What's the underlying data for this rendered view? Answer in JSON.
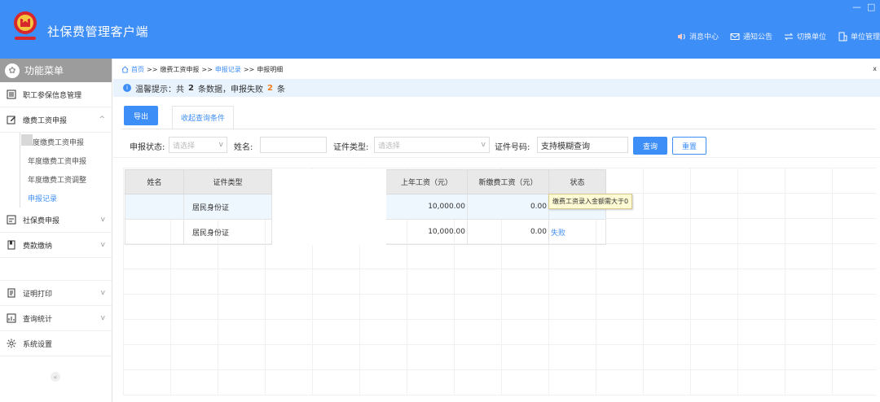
{
  "header": {
    "title": "社保费管理客户端",
    "window_controls": [
      "—",
      "□"
    ],
    "nav": [
      {
        "label": "消息中心",
        "icon": "speaker-icon"
      },
      {
        "label": "通知公告",
        "icon": "mail-icon"
      },
      {
        "label": "切换单位",
        "icon": "switch-icon"
      },
      {
        "label": "单位管理",
        "icon": "building-icon"
      }
    ]
  },
  "sidebar": {
    "title": "功能菜单",
    "items": [
      {
        "label": "职工参保信息管理"
      },
      {
        "label": "缴费工资申报"
      },
      {
        "label": "社保费申报"
      },
      {
        "label": "费款缴纳"
      },
      {
        "label": "证明打印"
      },
      {
        "label": "查询统计"
      },
      {
        "label": "系统设置"
      }
    ],
    "sub_items": [
      {
        "label": "度缴费工资申报"
      },
      {
        "label": "年度缴费工资申报"
      },
      {
        "label": "年度缴费工资调整"
      },
      {
        "label": "申报记录"
      }
    ],
    "chevron_up": "^",
    "chevron_down": "v",
    "collapse": "«"
  },
  "breadcrumb": {
    "home": "首页",
    "sep": ">>",
    "level1": "缴费工资申报",
    "level2": "申报记录",
    "level3": "申报明细",
    "close": "x"
  },
  "notice": {
    "icon": "i",
    "prefix": "温馨提示：共",
    "count": "2",
    "middle": "条数据，申报失败",
    "fail_count": "2",
    "suffix": "条"
  },
  "toolbar": {
    "export_label": "导出",
    "tab_label": "收起查询条件"
  },
  "filters": {
    "status_label": "申报状态:",
    "status_placeholder": "请选择",
    "name_label": "姓名:",
    "name_value": "",
    "idtype_label": "证件类型:",
    "idtype_placeholder": "请选择",
    "idno_label": "证件号码:",
    "idno_value": "支持模糊查询",
    "query_label": "查询",
    "reset_label": "重置",
    "dropdown_glyph": "v"
  },
  "table": {
    "headers": [
      "姓名",
      "证件类型",
      "",
      "上年工资（元）",
      "新缴费工资（元）",
      "状态"
    ],
    "rows": [
      {
        "name": "",
        "id_type": "居民身份证",
        "id_no": "",
        "last_salary": "10,000.00",
        "new_salary": "0.00",
        "status": ""
      },
      {
        "name": "",
        "id_type": "居民身份证",
        "id_no": "",
        "last_salary": "10,000.00",
        "new_salary": "0.00",
        "status": "失败"
      }
    ]
  },
  "tooltip": {
    "text": "缴费工资录入金额需大于0"
  },
  "colors": {
    "primary": "#3e8ef7",
    "notice_bg": "#e8f3fe",
    "fail_count": "#f07c1b"
  }
}
